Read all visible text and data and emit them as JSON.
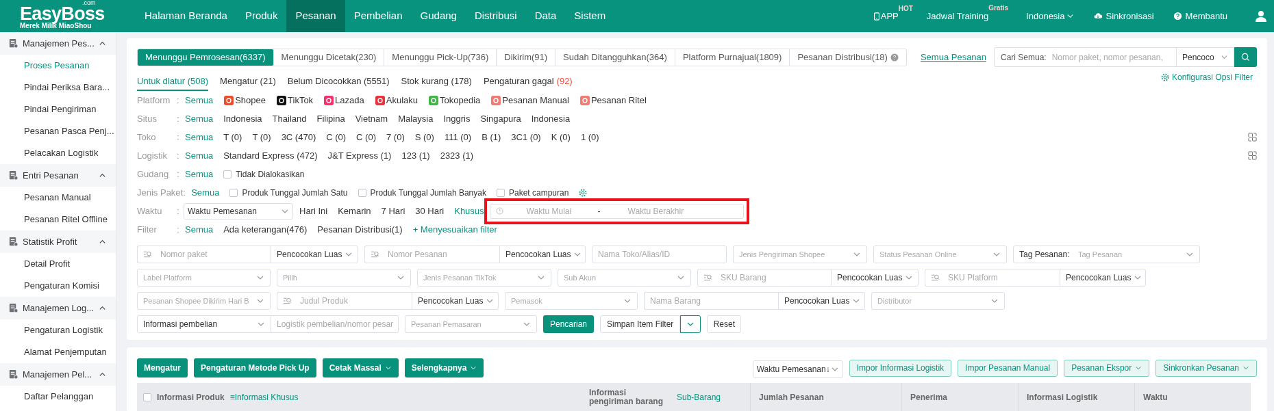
{
  "topbar": {
    "logo": "EasyBoss",
    "logo_suffix": ".com",
    "logo_tagline": "Merek Milik MiaoShou",
    "nav": [
      {
        "label": "Halaman Beranda",
        "selected": false
      },
      {
        "label": "Produk",
        "selected": false
      },
      {
        "label": "Pesanan",
        "selected": true
      },
      {
        "label": "Pembelian",
        "selected": false
      },
      {
        "label": "Gudang",
        "selected": false
      },
      {
        "label": "Distribusi",
        "selected": false
      },
      {
        "label": "Data",
        "selected": false
      },
      {
        "label": "Sistem",
        "selected": false
      }
    ],
    "app": {
      "label": "APP",
      "badge": "HOT"
    },
    "training": {
      "label": "Jadwal Training",
      "badge": "Gratis"
    },
    "language": "Indonesia",
    "sync": "Sinkronisasi",
    "help": "Membantu"
  },
  "sidebar": [
    {
      "title": "Manajemen Pes...",
      "expanded": true,
      "items": [
        {
          "label": "Proses Pesanan",
          "selected": true
        },
        {
          "label": "Pindai Periksa Bara...",
          "selected": false
        },
        {
          "label": "Pindai Pengiriman",
          "selected": false
        },
        {
          "label": "Pesanan Pasca Penj...",
          "selected": false
        },
        {
          "label": "Pelacakan Logistik",
          "selected": false
        }
      ]
    },
    {
      "title": "Entri Pesanan",
      "expanded": true,
      "items": [
        {
          "label": "Pesanan Manual",
          "selected": false
        },
        {
          "label": "Pesanan Ritel Offline",
          "selected": false
        }
      ]
    },
    {
      "title": "Statistik Profit",
      "expanded": true,
      "items": [
        {
          "label": "Detail Profit",
          "selected": false
        },
        {
          "label": "Pengaturan Komisi",
          "selected": false
        }
      ]
    },
    {
      "title": "Manajemen Log...",
      "expanded": true,
      "items": [
        {
          "label": "Pengaturan Logistik",
          "selected": false
        },
        {
          "label": "Alamat Penjemputan",
          "selected": false
        }
      ]
    },
    {
      "title": "Manajemen Pel...",
      "expanded": true,
      "items": [
        {
          "label": "Daftar Pelanggan",
          "selected": false
        }
      ]
    }
  ],
  "tabs": [
    {
      "label": "Menunggu Pemrosesan(6337)",
      "selected": true
    },
    {
      "label": "Menunggu Dicetak(230)",
      "selected": false
    },
    {
      "label": "Menunggu Pick-Up(736)",
      "selected": false
    },
    {
      "label": "Dikirim(91)",
      "selected": false
    },
    {
      "label": "Sudah Ditangguhkan(364)",
      "selected": false
    },
    {
      "label": "Platform Purnajual(1809)",
      "selected": false
    },
    {
      "label": "Pesanan Distribusi(18)",
      "selected": false,
      "help": true
    }
  ],
  "all_orders_link": "Semua Pesanan",
  "search": {
    "label": "Cari Semua:",
    "placeholder": "Nomor paket, nomor pesanan,",
    "match": "Pencoco"
  },
  "subtabs": [
    {
      "label": "Untuk diatur (508)",
      "selected": true
    },
    {
      "label": "Mengatur (21)",
      "selected": false
    },
    {
      "label": "Belum Dicocokkan (5551)",
      "selected": false
    },
    {
      "label": "Stok kurang (178)",
      "selected": false
    },
    {
      "label": "Pengaturan gagal",
      "alert_count": "(92)",
      "selected": false
    }
  ],
  "filter_config": "Konfigurasi Opsi Filter",
  "filters": [
    {
      "label": "Platform",
      "colon": ":",
      "options": [
        {
          "kind": "option",
          "text": "Semua",
          "selected": true
        },
        {
          "kind": "platform",
          "text": "Shopee",
          "selected": false,
          "color": "#ee4d2d"
        },
        {
          "kind": "platform",
          "text": "TikTok",
          "selected": false,
          "color": "#111111"
        },
        {
          "kind": "platform",
          "text": "Lazada",
          "selected": false,
          "color": "#f5306a"
        },
        {
          "kind": "platform",
          "text": "Akulaku",
          "selected": false,
          "color": "#e8323c"
        },
        {
          "kind": "platform",
          "text": "Tokopedia",
          "selected": false,
          "color": "#42b549"
        },
        {
          "kind": "platform",
          "text": "Pesanan Manual",
          "selected": false,
          "color": "#f07b73"
        },
        {
          "kind": "platform",
          "text": "Pesanan Ritel",
          "selected": false,
          "color": "#f07b73"
        }
      ]
    },
    {
      "label": "Situs",
      "colon": ":",
      "options": [
        {
          "kind": "option",
          "text": "Semua",
          "selected": true
        },
        {
          "kind": "option",
          "text": "Indonesia",
          "selected": false
        },
        {
          "kind": "option",
          "text": "Thailand",
          "selected": false
        },
        {
          "kind": "option",
          "text": "Filipina",
          "selected": false
        },
        {
          "kind": "option",
          "text": "Vietnam",
          "selected": false
        },
        {
          "kind": "option",
          "text": "Malaysia",
          "selected": false
        },
        {
          "kind": "option",
          "text": "Inggris",
          "selected": false
        },
        {
          "kind": "option",
          "text": "Singapura",
          "selected": false
        },
        {
          "kind": "option",
          "text": "Indonesia",
          "selected": false
        }
      ]
    },
    {
      "label": "Toko",
      "colon": ":",
      "copyable": true,
      "options": [
        {
          "kind": "option",
          "text": "Semua",
          "selected": true
        },
        {
          "kind": "option",
          "text": "T (0)",
          "selected": false
        },
        {
          "kind": "option",
          "text": "T (0)",
          "selected": false
        },
        {
          "kind": "option",
          "text": "3C (470)",
          "selected": false
        },
        {
          "kind": "option",
          "text": "C (0)",
          "selected": false
        },
        {
          "kind": "option",
          "text": "C (0)",
          "selected": false
        },
        {
          "kind": "option",
          "text": "7 (0)",
          "selected": false
        },
        {
          "kind": "option",
          "text": "S (0)",
          "selected": false
        },
        {
          "kind": "option",
          "text": "111 (0)",
          "selected": false
        },
        {
          "kind": "option",
          "text": "B (1)",
          "selected": false
        },
        {
          "kind": "option",
          "text": "3C1 (0)",
          "selected": false
        },
        {
          "kind": "option",
          "text": "K (0)",
          "selected": false
        },
        {
          "kind": "option",
          "text": "1 (0)",
          "selected": false
        }
      ]
    },
    {
      "label": "Logistik",
      "colon": ":",
      "copyable": true,
      "options": [
        {
          "kind": "option",
          "text": "Semua",
          "selected": true
        },
        {
          "kind": "option",
          "text": "Standard Express (472)",
          "selected": false
        },
        {
          "kind": "option",
          "text": "J&T Express (1)",
          "selected": false
        },
        {
          "kind": "option",
          "text": "123 (1)",
          "selected": false
        },
        {
          "kind": "option",
          "text": "2323 (1)",
          "selected": false
        }
      ]
    },
    {
      "label": "Gudang",
      "colon": ":",
      "options": [
        {
          "kind": "option",
          "text": "Semua",
          "selected": true
        },
        {
          "kind": "checkbox",
          "text": "Tidak Dialokasikan",
          "checked": false
        }
      ]
    },
    {
      "label": "Jenis Paket",
      "colon": ":",
      "settings": true,
      "options": [
        {
          "kind": "option",
          "text": "Semua",
          "selected": true
        },
        {
          "kind": "checkbox",
          "text": "Produk Tunggal Jumlah Satu",
          "checked": false
        },
        {
          "kind": "checkbox",
          "text": "Produk Tunggal Jumlah Banyak",
          "checked": false
        },
        {
          "kind": "checkbox",
          "text": "Paket campuran",
          "checked": false
        }
      ]
    },
    {
      "label": "Waktu",
      "colon": ":",
      "options": [
        {
          "kind": "select",
          "text": "Waktu Pemesanan"
        },
        {
          "kind": "option",
          "text": "Hari Ini",
          "selected": false
        },
        {
          "kind": "option",
          "text": "Kemarin",
          "selected": false
        },
        {
          "kind": "option",
          "text": "7 Hari",
          "selected": false
        },
        {
          "kind": "option",
          "text": "30 Hari",
          "selected": false
        },
        {
          "kind": "option",
          "text": "Khusus",
          "selected": true
        },
        {
          "kind": "date_range",
          "start": "Waktu Mulai",
          "separator": "-",
          "end": "Waktu Berakhir",
          "highlighted": true
        }
      ]
    },
    {
      "label": "Filter",
      "colon": ":",
      "options": [
        {
          "kind": "option",
          "text": "Semua",
          "selected": true
        },
        {
          "kind": "option",
          "text": "Ada keterangan(476)",
          "selected": false
        },
        {
          "kind": "option",
          "text": "Pesanan Distribusi(1)",
          "selected": false
        },
        {
          "kind": "link",
          "text": "+ Menyesuaikan filter"
        }
      ]
    }
  ],
  "field_rows": [
    [
      {
        "kind": "search",
        "placeholder": "Nomor paket",
        "match": "Pencocokan Luas"
      },
      {
        "kind": "search",
        "placeholder": "Nomor Pesanan",
        "match": "Pencocokan Luas"
      },
      {
        "kind": "input",
        "placeholder": "Nama Toko/Alias/ID"
      },
      {
        "kind": "select",
        "placeholder": "Jenis Pengiriman Shopee"
      },
      {
        "kind": "select",
        "placeholder": "Status Pesanan Online"
      },
      {
        "kind": "tag_select",
        "label": "Tag Pesanan:",
        "placeholder": "Tag Pesanan"
      }
    ],
    [
      {
        "kind": "select",
        "placeholder": "Label Platform"
      },
      {
        "kind": "select",
        "placeholder": "Pilih"
      },
      {
        "kind": "select",
        "placeholder": "Jenis Pesanan TikTok"
      },
      {
        "kind": "select",
        "placeholder": "Sub Akun"
      },
      {
        "kind": "search",
        "placeholder": "SKU Barang",
        "match": "Pencocokan Luas"
      },
      {
        "kind": "search",
        "placeholder": "SKU Platform",
        "match": "Pencocokan Luas"
      }
    ],
    [
      {
        "kind": "select",
        "placeholder": "Pesanan Shopee Dikirim Hari B"
      },
      {
        "kind": "search",
        "placeholder": "Judul Produk",
        "match": "Pencocokan Luas"
      },
      {
        "kind": "select",
        "placeholder": "Pemasok"
      },
      {
        "kind": "input_match",
        "placeholder": "Nama Barang",
        "match": "Pencocokan Luas"
      },
      {
        "kind": "select",
        "placeholder": "Distributor"
      }
    ],
    [
      {
        "kind": "select_input",
        "value": "Informasi pembelian",
        "placeholder": "Logistik pembelian/nomor pesar"
      },
      {
        "kind": "select",
        "placeholder": "Pesanan Pemasaran"
      },
      {
        "kind": "primary",
        "label": "Pencarian"
      },
      {
        "kind": "split",
        "label": "Simpan Item Filter"
      },
      {
        "kind": "plain",
        "label": "Reset"
      }
    ]
  ],
  "actions": [
    {
      "label": "Mengatur",
      "dropdown": false
    },
    {
      "label": "Pengaturan Metode Pick Up",
      "dropdown": false
    },
    {
      "label": "Cetak Massal",
      "dropdown": true
    },
    {
      "label": "Selengkapnya",
      "dropdown": true
    }
  ],
  "sort": "Waktu Pemesanan↓",
  "secondary_actions": [
    {
      "label": "Impor Informasi Logistik",
      "dropdown": false
    },
    {
      "label": "Impor Pesanan Manual",
      "dropdown": false
    },
    {
      "label": "Pesanan Ekspor",
      "dropdown": true
    },
    {
      "label": "Sinkronkan Pesanan",
      "dropdown": true
    }
  ],
  "table": {
    "select_all_checked": false,
    "columns": [
      {
        "label": "Informasi Produk",
        "extra": "≡Informasi Khusus"
      },
      {
        "label": "Informasi pengiriman barang",
        "extra": "Sub-Barang"
      },
      {
        "label": "Jumlah Pesanan"
      },
      {
        "label": "Penerima"
      },
      {
        "label": "Informasi Logistik"
      },
      {
        "label": "Waktu"
      }
    ]
  }
}
